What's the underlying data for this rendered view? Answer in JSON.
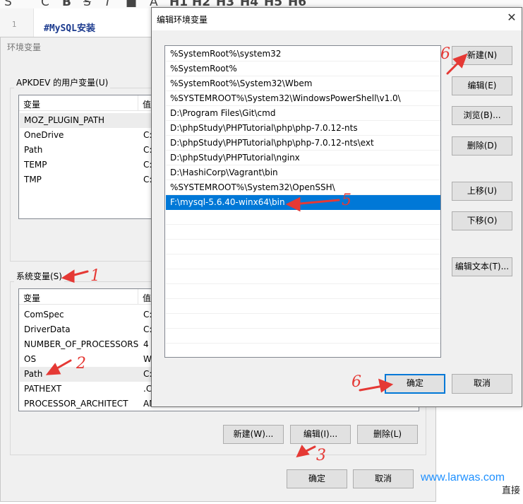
{
  "editor": {
    "line_number": "1",
    "code_line": "#MySQL安装",
    "toolbar_glyphs": [
      "S",
      "C",
      "B",
      "S",
      "I",
      "■",
      "A",
      "H1",
      "H2",
      "H3",
      "H4",
      "H5",
      "H6"
    ]
  },
  "env_dialog": {
    "title": "环境变量",
    "user_group_label": "APKDEV 的用户变量(U)",
    "sys_group_label": "系统变量(S)",
    "col_variable": "变量",
    "col_value": "值",
    "user_vars": [
      {
        "name": "MOZ_PLUGIN_PATH",
        "value": ""
      },
      {
        "name": "OneDrive",
        "value": "C:"
      },
      {
        "name": "Path",
        "value": "C:"
      },
      {
        "name": "TEMP",
        "value": "C:"
      },
      {
        "name": "TMP",
        "value": "C:"
      }
    ],
    "sys_vars": [
      {
        "name": "ComSpec",
        "value": "C:"
      },
      {
        "name": "DriverData",
        "value": "C:"
      },
      {
        "name": "NUMBER_OF_PROCESSORS",
        "value": "4"
      },
      {
        "name": "OS",
        "value": "W"
      },
      {
        "name": "Path",
        "value": "C:"
      },
      {
        "name": "PATHEXT",
        "value": ".C"
      },
      {
        "name": "PROCESSOR_ARCHITECT",
        "value": "AM"
      }
    ],
    "btn_new": "新建(W)...",
    "btn_edit": "编辑(I)...",
    "btn_delete": "删除(L)",
    "btn_ok": "确定",
    "btn_cancel": "取消"
  },
  "edit_dialog": {
    "title": "编辑环境变量",
    "paths": [
      "%SystemRoot%\\system32",
      "%SystemRoot%",
      "%SystemRoot%\\System32\\Wbem",
      "%SYSTEMROOT%\\System32\\WindowsPowerShell\\v1.0\\",
      "D:\\Program Files\\Git\\cmd",
      "D:\\phpStudy\\PHPTutorial\\php\\php-7.0.12-nts",
      "D:\\phpStudy\\PHPTutorial\\php\\php-7.0.12-nts\\ext",
      "D:\\phpStudy\\PHPTutorial\\nginx",
      "D:\\HashiCorp\\Vagrant\\bin",
      "%SYSTEMROOT%\\System32\\OpenSSH\\",
      "F:\\mysql-5.6.40-winx64\\bin"
    ],
    "selected_index": 10,
    "btn_new": "新建(N)",
    "btn_edit": "编辑(E)",
    "btn_browse": "浏览(B)...",
    "btn_delete": "删除(D)",
    "btn_up": "上移(U)",
    "btn_down": "下移(O)",
    "btn_edit_text": "编辑文本(T)...",
    "btn_ok": "确定",
    "btn_cancel": "取消"
  },
  "annotations": [
    "1",
    "2",
    "3",
    "5",
    "6",
    "6"
  ],
  "watermark": "www.larwas.com",
  "corner_text": "直接",
  "colors": {
    "annotation": "#e53935",
    "selection": "#0078d7",
    "watermark": "#1e90ff"
  }
}
